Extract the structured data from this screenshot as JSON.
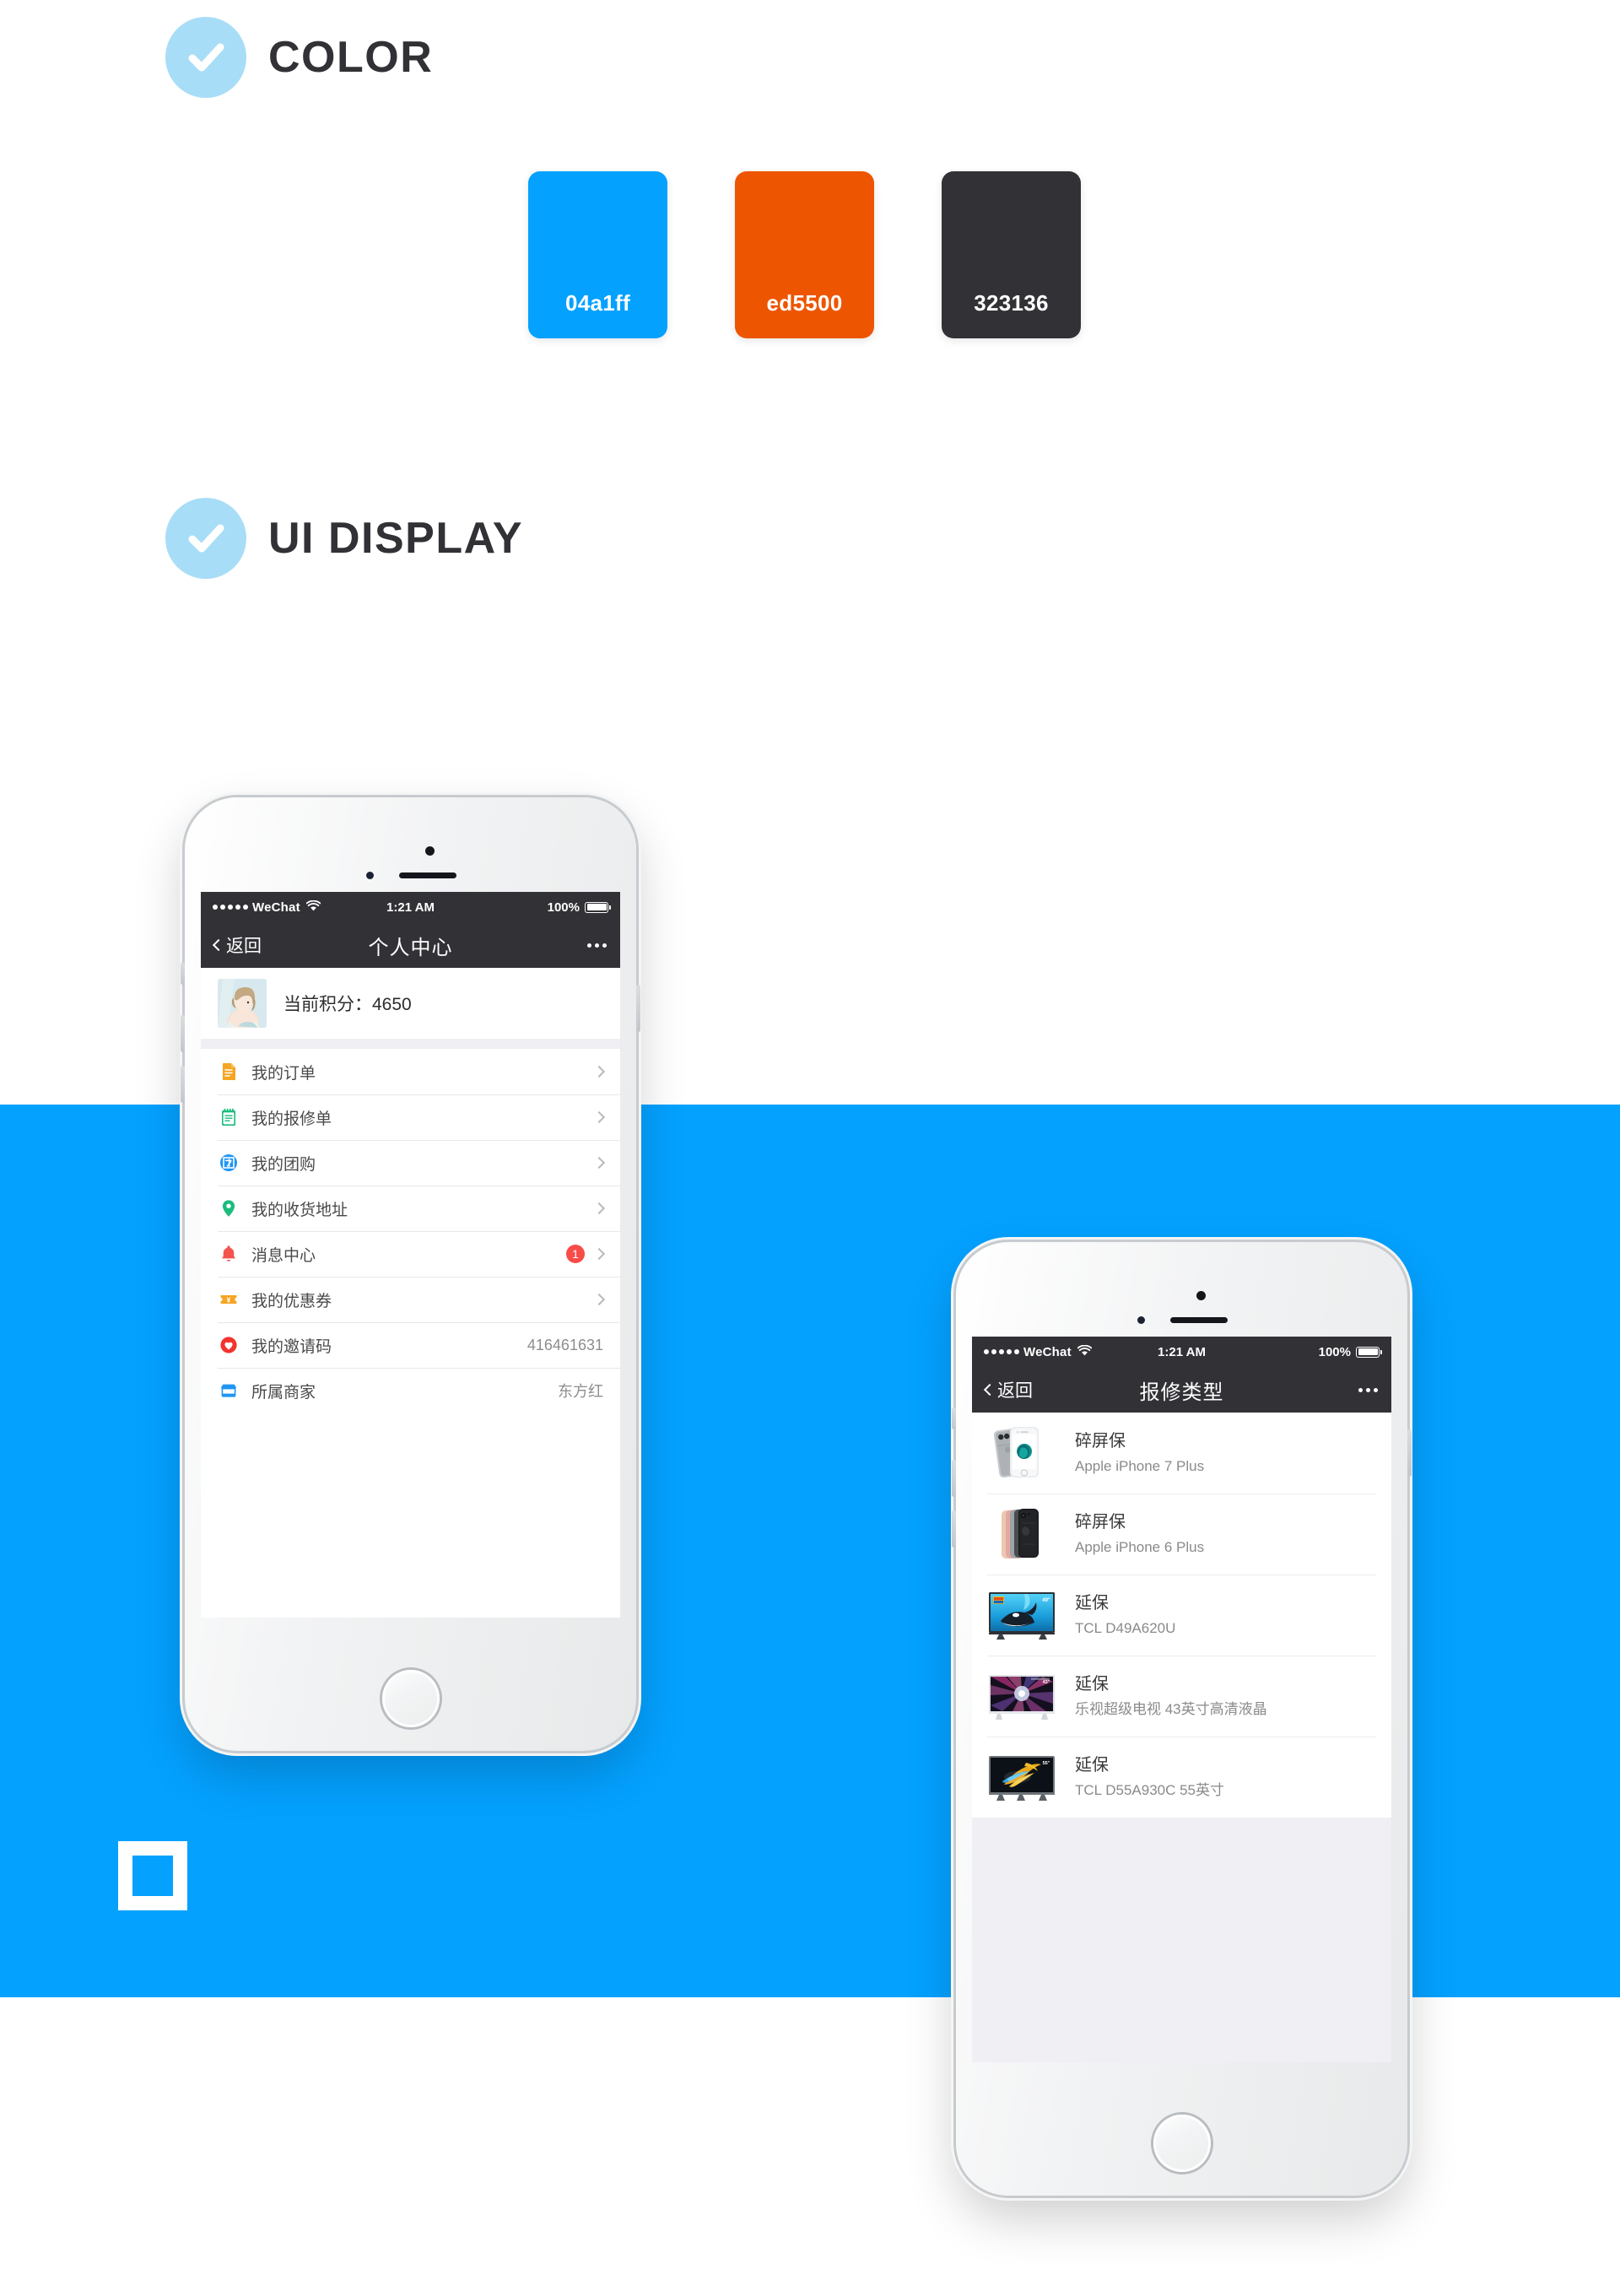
{
  "sections": {
    "color": {
      "title": "COLOR",
      "icon": "check-circle-icon"
    },
    "ui_display": {
      "title": "UI DISPLAY",
      "icon": "check-circle-icon"
    }
  },
  "palette": [
    {
      "hex": "04a1ff",
      "label": "04a1ff"
    },
    {
      "hex": "ed5500",
      "label": "ed5500"
    },
    {
      "hex": "323136",
      "label": "323136"
    }
  ],
  "brand": {
    "accent_blue": "#04a1ff",
    "accent_orange": "#ed5500",
    "accent_dark": "#323136",
    "badge_blue": "#a8ddf7"
  },
  "phone1": {
    "statusbar": {
      "carrier": "WeChat",
      "time": "1:21 AM",
      "battery": "100%"
    },
    "navbar": {
      "back_label": "返回",
      "title": "个人中心",
      "more_label": "•••"
    },
    "profile": {
      "points_label": "当前积分：4650"
    },
    "menu": [
      {
        "icon": "document-icon",
        "label": "我的订单",
        "value": "",
        "badge": "",
        "chevron": true
      },
      {
        "icon": "notepad-icon",
        "label": "我的报修单",
        "value": "",
        "badge": "",
        "chevron": true
      },
      {
        "icon": "groupbuy-icon",
        "label": "我的团购",
        "value": "",
        "badge": "",
        "chevron": true
      },
      {
        "icon": "location-pin-icon",
        "label": "我的收货地址",
        "value": "",
        "badge": "",
        "chevron": true
      },
      {
        "icon": "bell-icon",
        "label": "消息中心",
        "value": "",
        "badge": "1",
        "chevron": true
      },
      {
        "icon": "coupon-icon",
        "label": "我的优惠券",
        "value": "",
        "badge": "",
        "chevron": true
      },
      {
        "icon": "heart-icon",
        "label": "我的邀请码",
        "value": "416461631",
        "badge": "",
        "chevron": false
      },
      {
        "icon": "shop-icon",
        "label": "所属商家",
        "value": "东方红",
        "badge": "",
        "chevron": false
      }
    ]
  },
  "phone2": {
    "statusbar": {
      "carrier": "WeChat",
      "time": "1:21 AM",
      "battery": "100%"
    },
    "navbar": {
      "back_label": "返回",
      "title": "报修类型",
      "more_label": "•••"
    },
    "products": [
      {
        "thumb": "iphone7plus-silver-thumb",
        "title": "碎屏保",
        "subtitle": "Apple iPhone 7 Plus"
      },
      {
        "thumb": "iphone6plus-colors-thumb",
        "title": "碎屏保",
        "subtitle": "Apple iPhone 6 Plus"
      },
      {
        "thumb": "tcl-orca-tv-thumb",
        "title": "延保",
        "subtitle": "TCL D49A620U"
      },
      {
        "thumb": "letv-starburst-tv-thumb",
        "title": "延保",
        "subtitle": "乐视超级电视 43英寸高清液晶"
      },
      {
        "thumb": "tcl-feather-tv-thumb",
        "title": "延保",
        "subtitle": "TCL D55A930C 55英寸"
      }
    ]
  },
  "logo_mark": {
    "name": "square-outline-logo"
  }
}
